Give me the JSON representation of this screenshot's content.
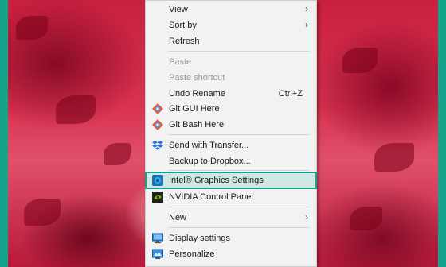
{
  "menu": {
    "items": [
      {
        "label": "View"
      },
      {
        "label": "Sort by"
      },
      {
        "label": "Refresh"
      },
      {
        "label": "Paste"
      },
      {
        "label": "Paste shortcut"
      },
      {
        "label": "Undo Rename",
        "shortcut": "Ctrl+Z"
      },
      {
        "label": "Git GUI Here"
      },
      {
        "label": "Git Bash Here"
      },
      {
        "label": "Send with Transfer..."
      },
      {
        "label": "Backup to Dropbox..."
      },
      {
        "label": "Intel® Graphics Settings"
      },
      {
        "label": "NVIDIA Control Panel"
      },
      {
        "label": "New"
      },
      {
        "label": "Display settings"
      },
      {
        "label": "Personalize"
      }
    ],
    "submenu_arrow": "›"
  },
  "colors": {
    "accent": "#16a38b",
    "highlight_bg": "#cfe8e4",
    "menu_bg": "#f2f2f2"
  }
}
